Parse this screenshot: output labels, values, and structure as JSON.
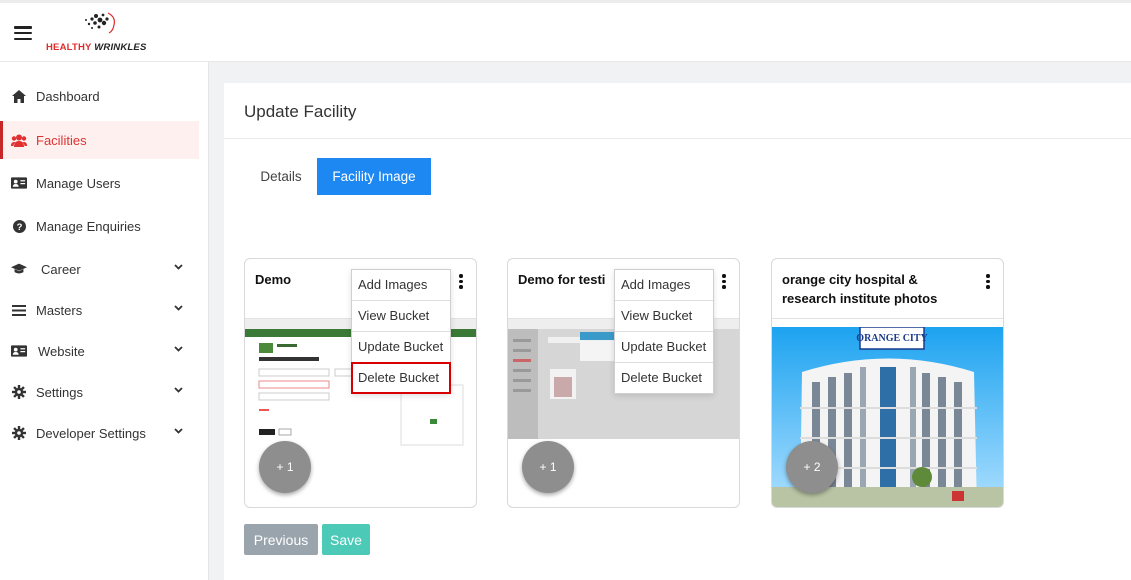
{
  "header": {
    "logo_text_a": "HEALTHY ",
    "logo_text_b": "WRINKLES"
  },
  "sidebar": {
    "items": [
      {
        "label": "Dashboard",
        "icon": "home-icon",
        "active": false,
        "chevron": false
      },
      {
        "label": "Facilities",
        "icon": "users-icon",
        "active": true,
        "chevron": false
      },
      {
        "label": "Manage Users",
        "icon": "id-card-icon",
        "active": false,
        "chevron": false
      },
      {
        "label": "Manage Enquiries",
        "icon": "question-circle-icon",
        "active": false,
        "chevron": false
      },
      {
        "label": "Career",
        "icon": "graduation-cap-icon",
        "active": false,
        "chevron": true
      },
      {
        "label": "Masters",
        "icon": "list-icon",
        "active": false,
        "chevron": true
      },
      {
        "label": "Website",
        "icon": "id-card-icon",
        "active": false,
        "chevron": true
      },
      {
        "label": "Settings",
        "icon": "gear-icon",
        "active": false,
        "chevron": true
      },
      {
        "label": "Developer Settings",
        "icon": "gear-icon",
        "active": false,
        "chevron": true
      }
    ]
  },
  "main": {
    "title": "Update Facility",
    "tabs": [
      {
        "label": "Details"
      },
      {
        "label": "Facility Image",
        "active": true
      }
    ],
    "cards": [
      {
        "title": "Demo",
        "extra_count": "+ 1"
      },
      {
        "title": "Demo for testi",
        "extra_count": "+ 1"
      },
      {
        "title_line1": "orange city hospital &",
        "title_line2": "research institute photos",
        "extra_count": "+ 2",
        "sign_text": "ORANGE CITY"
      }
    ],
    "menu": {
      "items": [
        "Add Images",
        "View Bucket",
        "Update Bucket",
        "Delete Bucket"
      ],
      "highlighted": "Delete Bucket"
    },
    "buttons": {
      "previous": "Previous",
      "save": "Save"
    }
  },
  "colors": {
    "accent": "#1e88f2",
    "active_nav": "#c62828",
    "save": "#4cc9b7",
    "previous": "#9aa4ad",
    "highlight_outline": "#d60000"
  }
}
